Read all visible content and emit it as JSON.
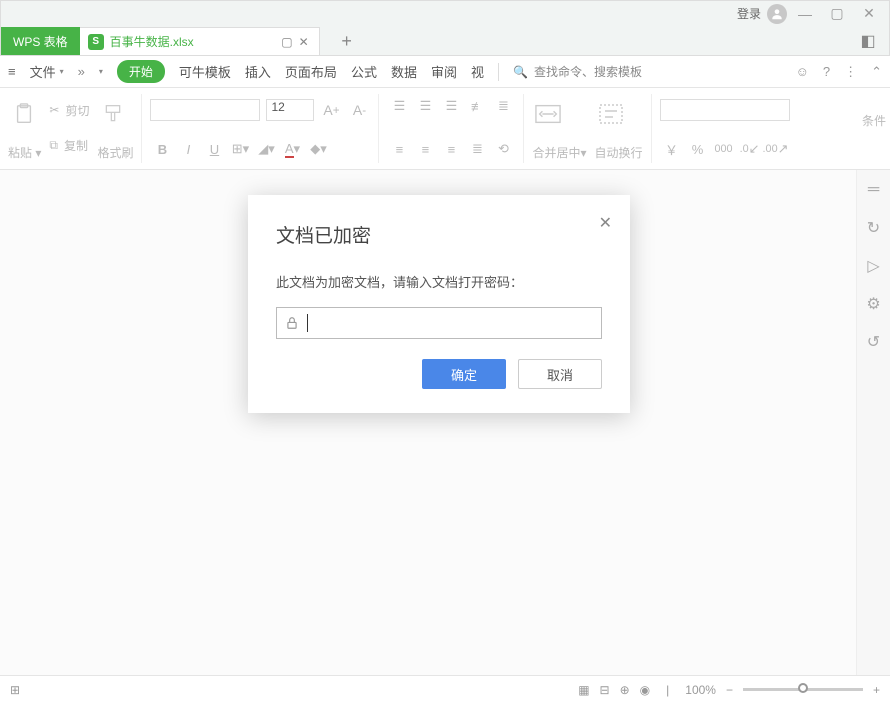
{
  "titlebar": {
    "login": "登录"
  },
  "tabs": {
    "app": "WPS 表格",
    "doc_icon": "S",
    "doc_name": "百事牛数据.xlsx"
  },
  "menu": {
    "file": "文件",
    "start": "开始",
    "template": "可牛模板",
    "insert": "插入",
    "layout": "页面布局",
    "formula": "公式",
    "data": "数据",
    "review": "审阅",
    "view_short": "视",
    "search_placeholder": "查找命令、搜索模板"
  },
  "ribbon": {
    "paste": "粘贴",
    "cut": "剪切",
    "copy": "复制",
    "format_painter": "格式刷",
    "font_size": "12",
    "merge": "合并居中",
    "wrap": "自动换行",
    "currency": "￥",
    "percent": "%",
    "cond": "条件"
  },
  "status": {
    "zoom": "100%"
  },
  "dialog": {
    "title": "文档已加密",
    "message": "此文档为加密文档，请输入文档打开密码：",
    "ok": "确定",
    "cancel": "取消"
  }
}
